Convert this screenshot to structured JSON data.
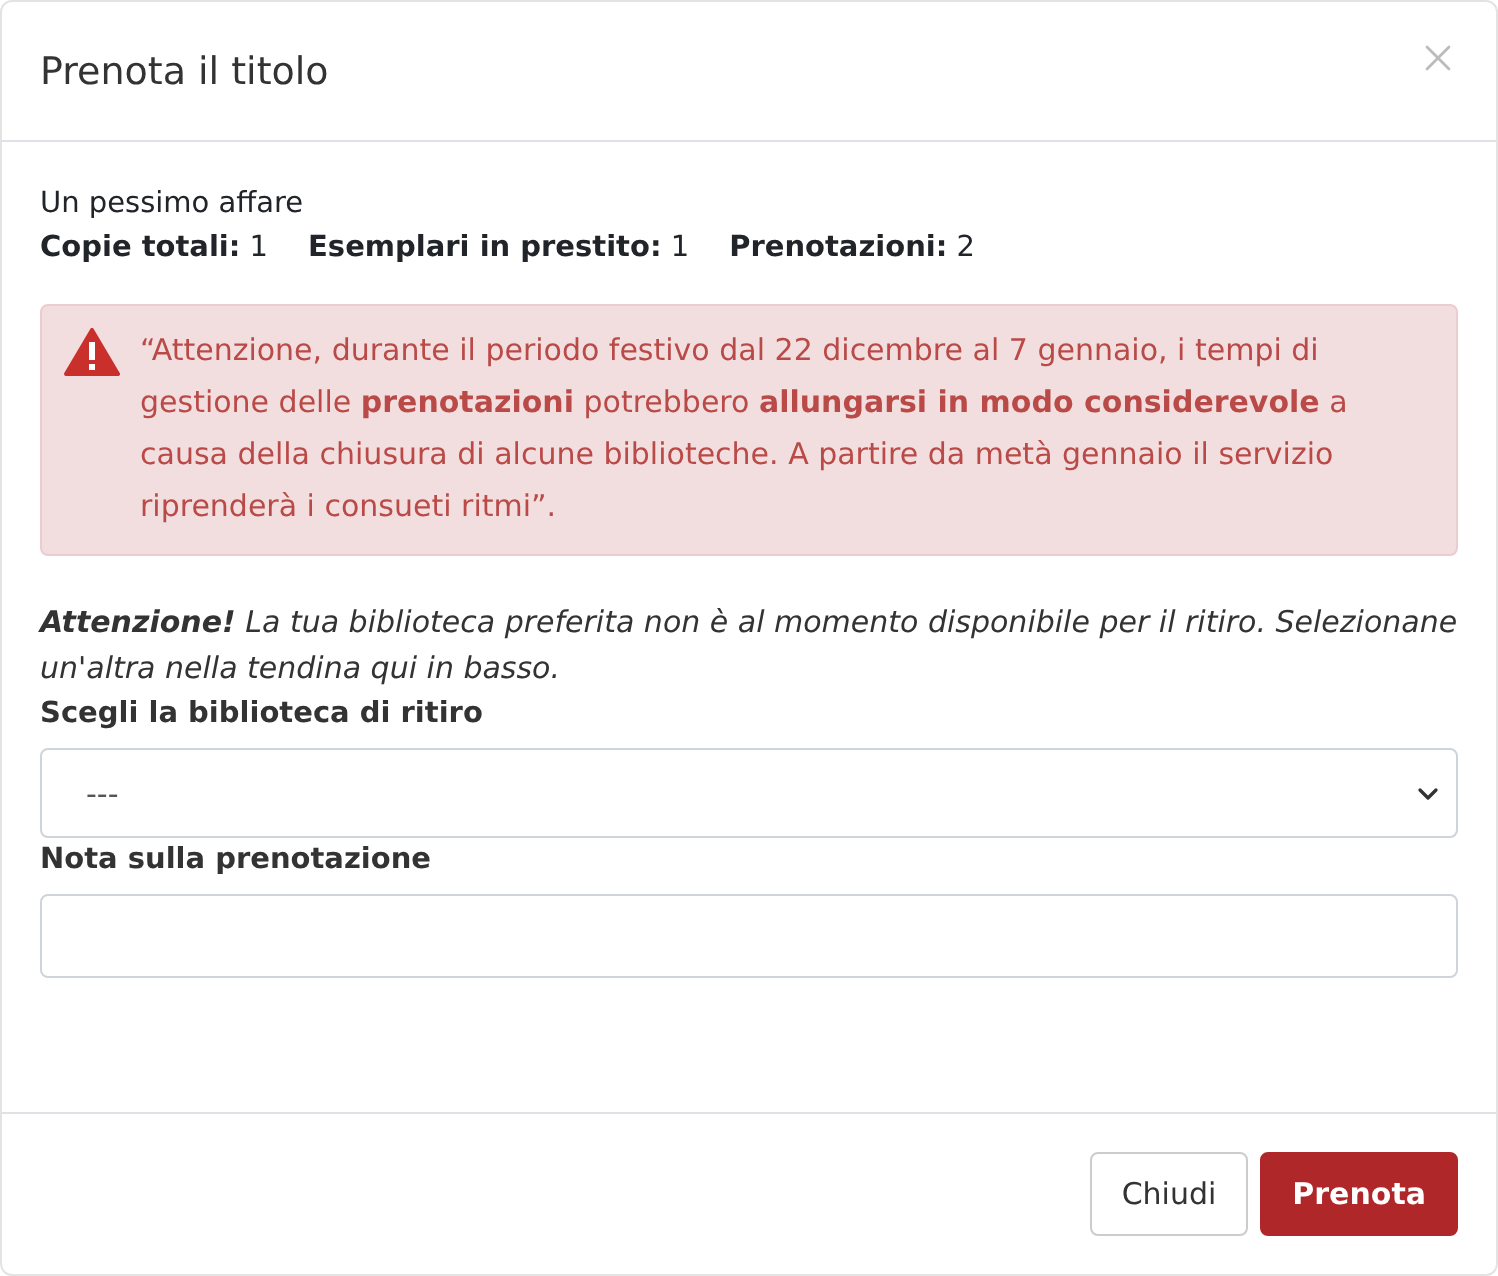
{
  "dialog": {
    "title": "Prenota il titolo"
  },
  "book": {
    "title": "Un pessimo affare",
    "stats": [
      "**Copie totali:** 1",
      "**Esemplari in prestito:** 1",
      "**Prenotazioni:** 2"
    ]
  },
  "alert": {
    "text": "“Attenzione, durante il periodo festivo dal 22 dicembre al 7 gennaio, i tempi di gestione delle **prenotazioni** potrebbero **allungarsi in modo considerevole** a causa della chiusura di alcune biblioteche. A partire da metà gennaio il servizio riprenderà i consueti ritmi”."
  },
  "notice": "**Attenzione!** La tua biblioteca preferita non è al momento disponibile per il ritiro. Selezionane un'altra nella tendina qui in basso.",
  "library_select": {
    "label": "Scegli la biblioteca di ritiro",
    "value": "---"
  },
  "note_field": {
    "label": "Nota sulla prenotazione"
  },
  "buttons": [
    {
      "label": "Chiudi",
      "kind": "secondary"
    },
    {
      "label": "Prenota",
      "kind": "primary"
    }
  ]
}
